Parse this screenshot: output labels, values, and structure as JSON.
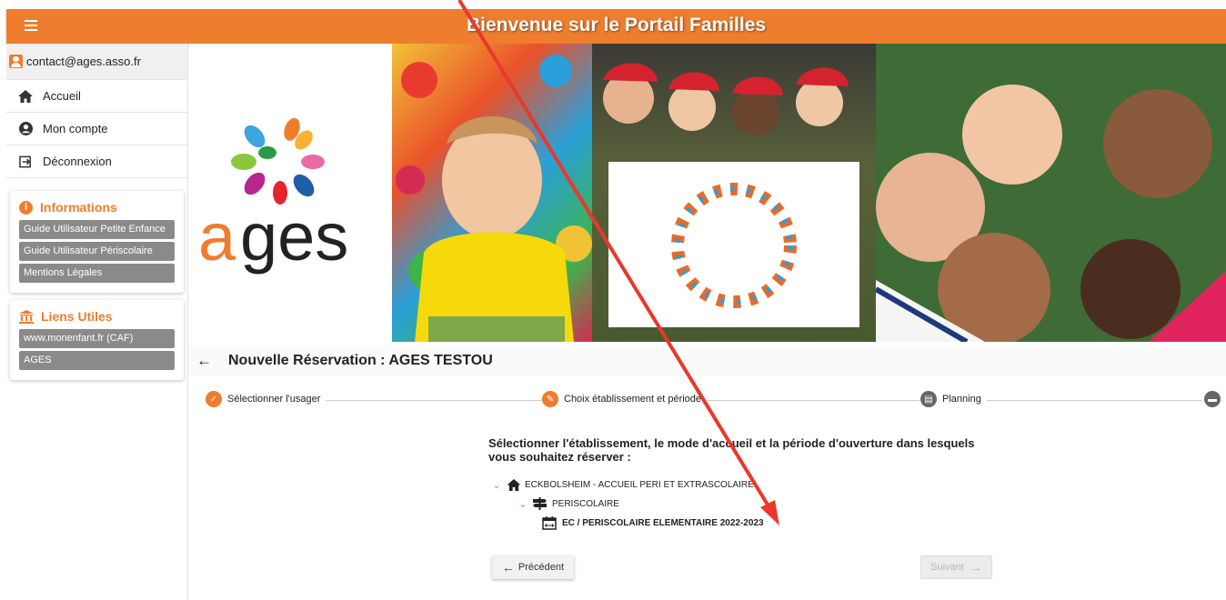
{
  "header": {
    "title": "Bienvenue sur le Portail Familles"
  },
  "sidebar": {
    "user_email": "contact@ages.asso.fr",
    "nav": [
      {
        "label": "Accueil",
        "icon": "home-icon"
      },
      {
        "label": "Mon compte",
        "icon": "account-icon"
      },
      {
        "label": "Déconnexion",
        "icon": "logout-icon"
      }
    ],
    "informations": {
      "title": "Informations",
      "links": [
        "Guide Utilisateur Petite Enfance",
        "Guide Utilisateur Périscolaire",
        "Mentions Légales"
      ]
    },
    "liens_utiles": {
      "title": "Liens Utiles",
      "links": [
        "www.monenfant.fr (CAF)",
        "AGES"
      ]
    }
  },
  "banner": {
    "logo_text": "ages"
  },
  "page": {
    "title": "Nouvelle Réservation : AGES TESTOU"
  },
  "stepper": {
    "steps": [
      {
        "label": "Sélectionner l'usager",
        "state": "done"
      },
      {
        "label": "Choix établissement et période",
        "state": "current"
      },
      {
        "label": "Planning",
        "state": "pending"
      },
      {
        "label": "",
        "state": "pending"
      }
    ]
  },
  "content": {
    "instruction": "Sélectionner l'établissement, le mode d'accueil et la période d'ouverture dans lesquels vous souhaitez réserver :",
    "tree": {
      "establishment": "ECKBOLSHEIM - ACCUEIL PERI ET EXTRASCOLAIRE",
      "mode": "PERISCOLAIRE",
      "period": "EC / PERISCOLAIRE ELEMENTAIRE 2022-2023"
    }
  },
  "buttons": {
    "previous": "Précédent",
    "next": "Suivant"
  },
  "colors": {
    "accent": "#ee7d2e",
    "annotation": "#e8392c"
  }
}
